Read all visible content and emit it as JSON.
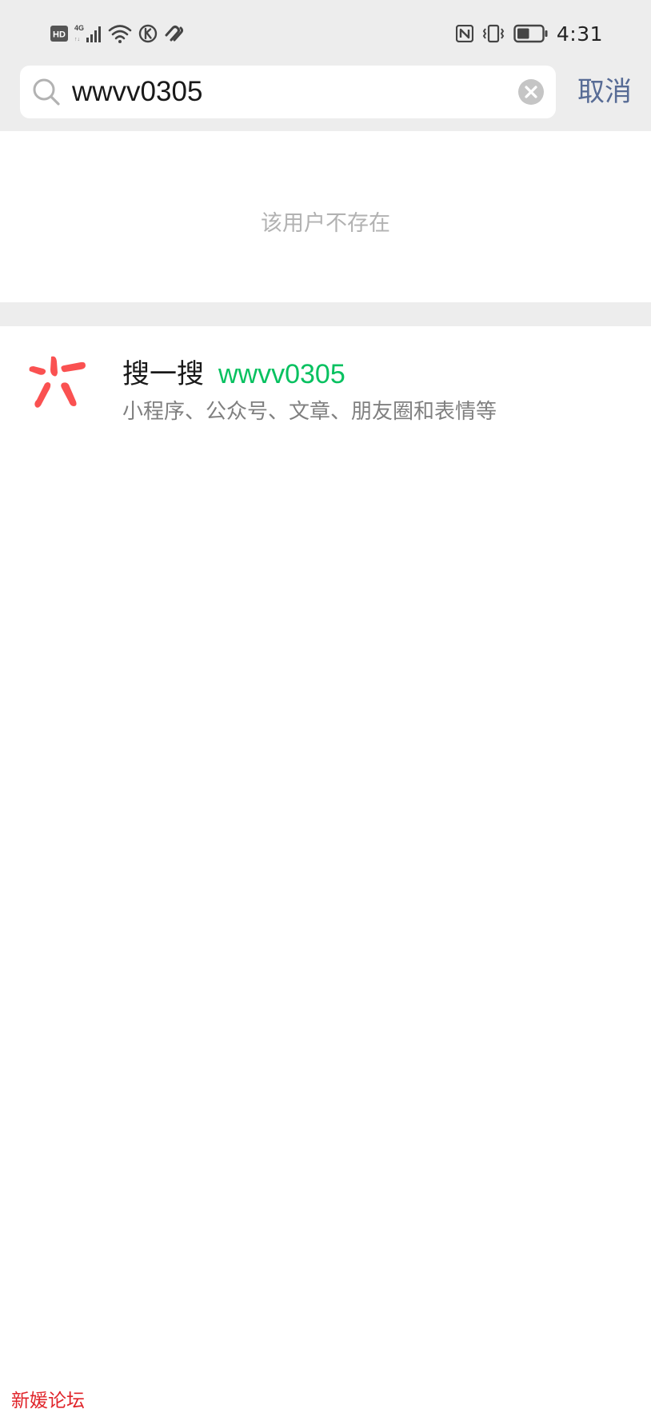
{
  "status_bar": {
    "left_icons": [
      "hd-icon",
      "signal-4g-icon",
      "wifi-icon",
      "k-app-icon",
      "heart-app-icon"
    ],
    "right_icons": [
      "nfc-icon",
      "vibrate-icon",
      "battery-icon"
    ],
    "battery_level": 0.5,
    "time": "4:31"
  },
  "search": {
    "query": "wwvv0305",
    "cancel_label": "取消"
  },
  "result": {
    "not_found_text": "该用户不存在"
  },
  "souyisou": {
    "title": "搜一搜",
    "keyword": "wwvv0305",
    "subtitle": "小程序、公众号、文章、朋友圈和表情等"
  },
  "watermark": "新媛论坛",
  "colors": {
    "accent_green": "#07c160",
    "link_blue": "#576b95",
    "watermark_red": "#e0242a",
    "logo_red": "#fa5151"
  }
}
